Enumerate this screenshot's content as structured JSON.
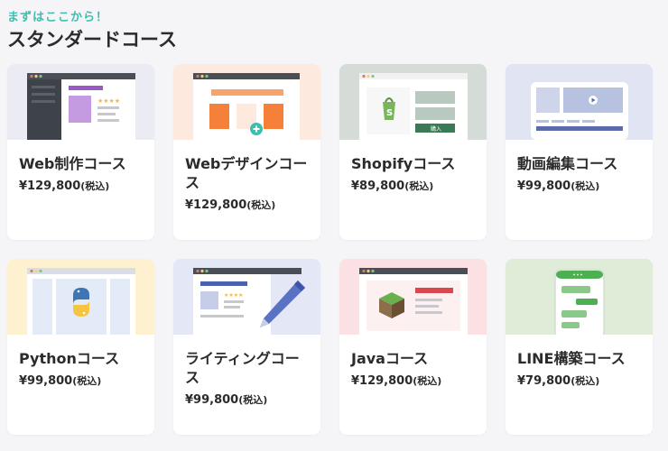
{
  "header": {
    "eyebrow": "まずはここから！",
    "title": "スタンダードコース"
  },
  "colors": {
    "accent": "#3cbfae",
    "price_text": "#2b2b2b"
  },
  "courses": [
    {
      "name": "Web制作コース",
      "price": "¥129,800",
      "tax": "(税込)",
      "thumb_bg": "#e8e8f2",
      "icon": "web-production-illustration-icon"
    },
    {
      "name": "Webデザインコース",
      "price": "¥129,800",
      "tax": "(税込)",
      "thumb_bg": "#fde9de",
      "icon": "web-design-illustration-icon"
    },
    {
      "name": "Shopifyコース",
      "price": "¥89,800",
      "tax": "(税込)",
      "thumb_bg": "#d5dcd8",
      "icon": "shopify-illustration-icon",
      "buy_label": "購入"
    },
    {
      "name": "動画編集コース",
      "price": "¥99,800",
      "tax": "(税込)",
      "thumb_bg": "#e0e4f3",
      "icon": "video-editing-illustration-icon"
    },
    {
      "name": "Pythonコース",
      "price": "¥99,800",
      "tax": "(税込)",
      "thumb_bg": "#fdf1cf",
      "icon": "python-illustration-icon"
    },
    {
      "name": "ライティングコース",
      "price": "¥99,800",
      "tax": "(税込)",
      "thumb_bg": "#e3e7f6",
      "icon": "writing-illustration-icon"
    },
    {
      "name": "Javaコース",
      "price": "¥129,800",
      "tax": "(税込)",
      "thumb_bg": "#fbe1e3",
      "icon": "java-illustration-icon"
    },
    {
      "name": "LINE構築コース",
      "price": "¥79,800",
      "tax": "(税込)",
      "thumb_bg": "#deecd8",
      "icon": "line-illustration-icon"
    }
  ]
}
